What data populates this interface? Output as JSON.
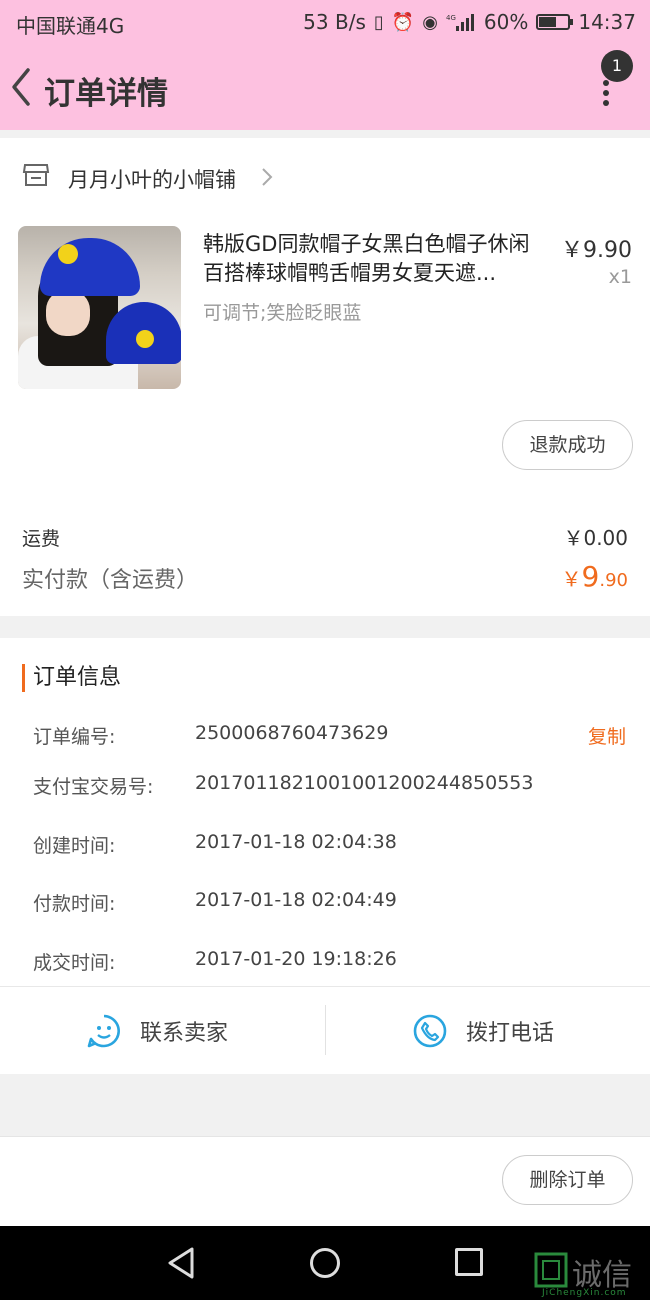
{
  "status_bar": {
    "carrier": "中国联通4G",
    "network_speed": "53 B/s",
    "battery": "60%",
    "battery_level": 0.6,
    "time": "14:37"
  },
  "header": {
    "title": "订单详情",
    "notification_count": "1"
  },
  "shop": {
    "name": "月月小叶的小帽铺"
  },
  "product": {
    "title": "韩版GD同款帽子女黑白色帽子休闲百搭棒球帽鸭舌帽男女夏天遮...",
    "price": "￥9.90",
    "quantity": "x1",
    "spec": "可调节;笑脸眨眼蓝",
    "refund_status": "退款成功"
  },
  "totals": {
    "shipping_label": "运费",
    "shipping_value": "￥0.00",
    "paid_label": "实付款（含运费）",
    "paid_currency": "￥",
    "paid_int": "9",
    "paid_dec": ".90"
  },
  "order_info": {
    "title": "订单信息",
    "copy_label": "复制",
    "rows": [
      {
        "label": "订单编号:",
        "value": "2500068760473629"
      },
      {
        "label": "支付宝交易号:",
        "value": "2017011821001001200244850553"
      },
      {
        "label": "创建时间:",
        "value": "2017-01-18 02:04:38"
      },
      {
        "label": "付款时间:",
        "value": "2017-01-18 02:04:49"
      },
      {
        "label": "成交时间:",
        "value": "2017-01-20 19:18:26"
      }
    ]
  },
  "contact": {
    "seller_label": "联系卖家",
    "phone_label": "拨打电话"
  },
  "footer": {
    "delete_label": "删除订单"
  },
  "watermark": {
    "text": "诚信",
    "subtext": "JiChengXin.com"
  },
  "colors": {
    "header_bg": "#fdc1e0",
    "accent": "#f06b1e"
  }
}
